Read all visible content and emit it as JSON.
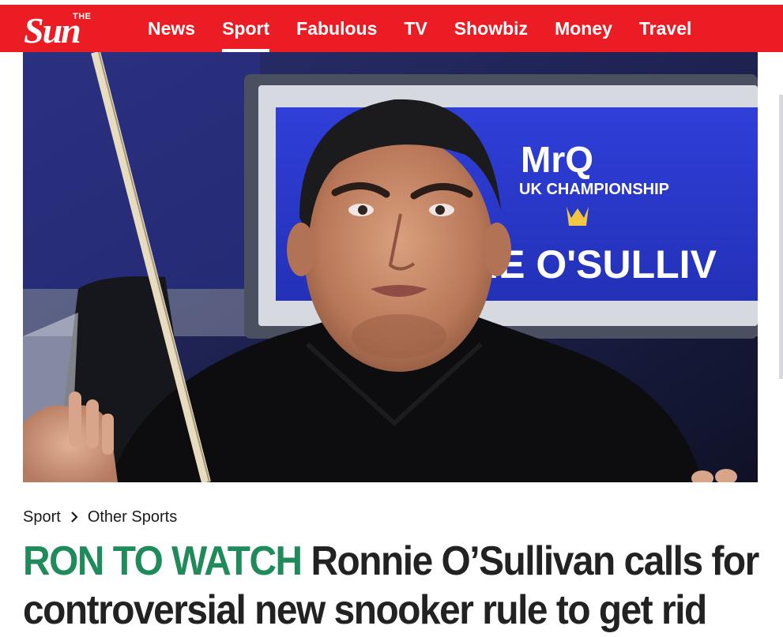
{
  "brand": {
    "logo_small": "THE",
    "logo_word": "Sun"
  },
  "nav": {
    "items": [
      {
        "label": "News"
      },
      {
        "label": "Sport",
        "active": true
      },
      {
        "label": "Fabulous"
      },
      {
        "label": "TV"
      },
      {
        "label": "Showbiz"
      },
      {
        "label": "Money"
      },
      {
        "label": "Travel"
      }
    ]
  },
  "hero": {
    "sign_brand": "MrQ",
    "sign_event": "UK CHAMPIONSHIP",
    "sign_name": "NE O'SULLIV"
  },
  "breadcrumb": {
    "section": "Sport",
    "subsection": "Other Sports"
  },
  "headline": {
    "kicker": "RON TO WATCH",
    "line1": "Ronnie O’Sullivan calls for",
    "line2": "controversial new snooker rule to get rid"
  },
  "colors": {
    "brand_red": "#eb1c24",
    "kicker_green": "#1f8a5a",
    "text": "#222222"
  }
}
